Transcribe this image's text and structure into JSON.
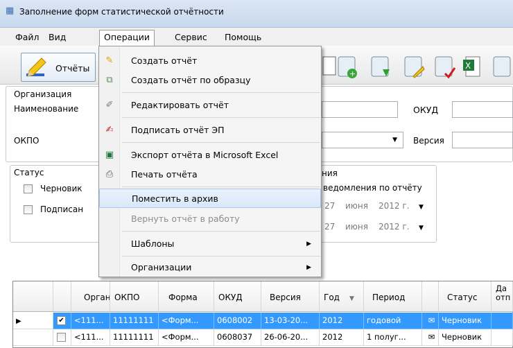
{
  "window": {
    "title": "Заполнение форм статистической отчётности"
  },
  "menubar": [
    "Файл",
    "Вид",
    "Операции",
    "Сервис",
    "Помощь"
  ],
  "toolbar": {
    "reports_label": "Отчёты"
  },
  "org_group": {
    "title": "Организация",
    "name_label": "Наименование",
    "okpo_label": "ОКПО",
    "okud_label": "ОКУД",
    "version_label": "Версия"
  },
  "status_group": {
    "title": "Статус",
    "draft_label": "Черновик",
    "signed_label": "Подписан"
  },
  "notif_group": {
    "title": "ния",
    "sub_label": "ведомления по отчёту",
    "date1": {
      "day": "27",
      "month": "июня",
      "year": "2012 г."
    },
    "date2": {
      "day": "27",
      "month": "июня",
      "year": "2012 г."
    }
  },
  "grid": {
    "headers": [
      "Органи",
      "ОКПО",
      "Форма",
      "ОКУД",
      "Версия",
      "Год",
      "Период",
      "Статус",
      "Да отп"
    ],
    "rows": [
      {
        "org": "<111...",
        "okpo": "11111111",
        "form": "<Форм...",
        "okud": "0608002",
        "version": "13-03-20...",
        "year": "2012",
        "period": "годовой",
        "status": "Черновик",
        "checked": true,
        "selected": true
      },
      {
        "org": "<111...",
        "okpo": "11111111",
        "form": "<Форм...",
        "okud": "0608037",
        "version": "26-06-20...",
        "year": "2012",
        "period": "1 полуг...",
        "status": "Черновик",
        "checked": false,
        "selected": false
      }
    ]
  },
  "dropdown": {
    "items": [
      {
        "label": "Создать отчёт",
        "icon": "pencil-icon"
      },
      {
        "label": "Создать отчёт по образцу",
        "icon": "copy-icon"
      },
      {
        "label": "Редактировать отчёт",
        "icon": "edit-icon"
      },
      {
        "label": "Подписать отчёт ЭП",
        "icon": "sign-icon"
      },
      {
        "label": "Экспорт отчёта в Microsoft Excel",
        "icon": "excel-icon"
      },
      {
        "label": "Печать отчёта",
        "icon": "printer-icon"
      },
      {
        "label": "Поместить в архив",
        "icon": ""
      },
      {
        "label": "Вернуть отчёт в работу",
        "icon": ""
      },
      {
        "label": "Шаблоны",
        "icon": ""
      },
      {
        "label": "Организации",
        "icon": ""
      }
    ]
  },
  "colors": {
    "selection": "#3399ff",
    "menu_highlight": "#d8e8fa"
  }
}
